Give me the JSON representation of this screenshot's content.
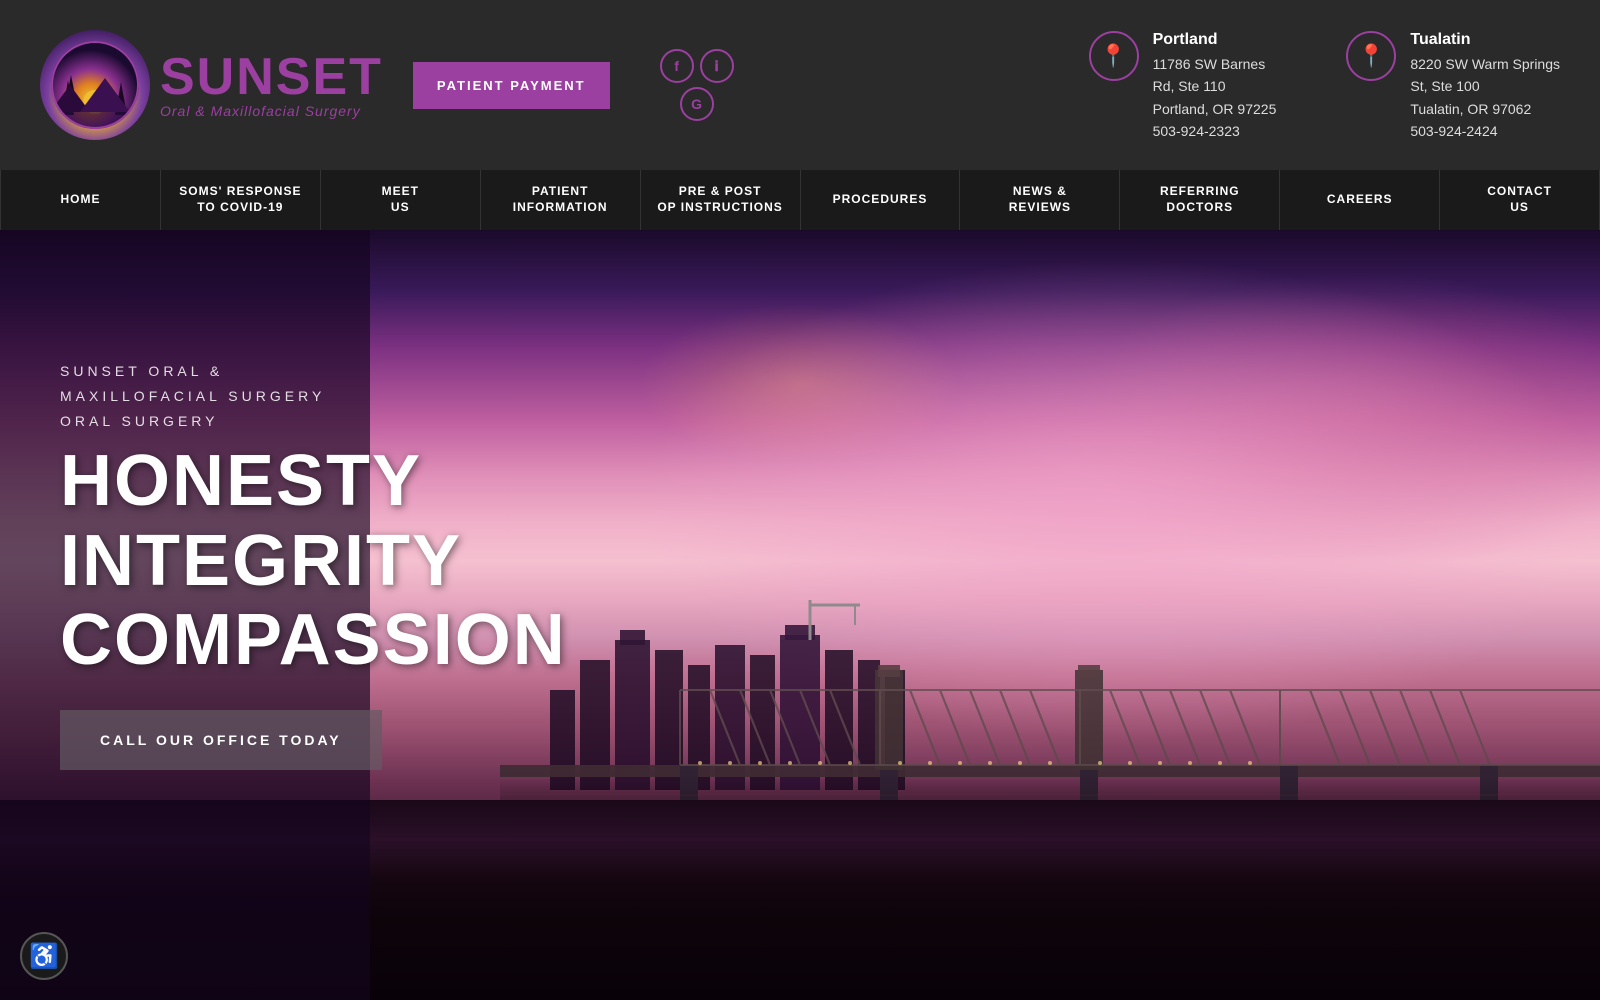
{
  "header": {
    "logo": {
      "brand": "SUNSET",
      "tagline": "Oral & Maxillofacial Surgery"
    },
    "payment_button": "PATIENT PAYMENT",
    "social": {
      "facebook": "f",
      "instagram": "G",
      "google": "G"
    },
    "location1": {
      "city": "Portland",
      "address_line1": "11786 SW Barnes",
      "address_line2": "Rd, Ste 110",
      "city_state_zip": "Portland, OR 97225",
      "phone": "503-924-2323"
    },
    "location2": {
      "city": "Tualatin",
      "address_line1": "8220 SW Warm Springs",
      "address_line2": "St, Ste 100",
      "city_state_zip": "Tualatin, OR 97062",
      "phone": "503-924-2424"
    }
  },
  "nav": {
    "items": [
      {
        "label": "HOME"
      },
      {
        "label": "SOMS' RESPONSE\nTO COVID-19"
      },
      {
        "label": "MEET\nUS"
      },
      {
        "label": "PATIENT\nINFORMATION"
      },
      {
        "label": "PRE & POST\nOP INSTRUCTIONS"
      },
      {
        "label": "PROCEDURES"
      },
      {
        "label": "NEWS &\nREVIEWS"
      },
      {
        "label": "REFERRING\nDOCTORS"
      },
      {
        "label": "CAREERS"
      },
      {
        "label": "CONTACT\nUS"
      }
    ]
  },
  "hero": {
    "subtitle_line1": "SUNSET ORAL &",
    "subtitle_line2": "MAXILLOFACIAL SURGERY",
    "subtitle_line3": "ORAL SURGERY",
    "headline_line1": "HONESTY",
    "headline_line2": "INTEGRITY",
    "headline_line3": "COMPASSION",
    "cta": "CALL OUR OFFICE TODAY"
  },
  "accessibility": {
    "label": "♿"
  }
}
